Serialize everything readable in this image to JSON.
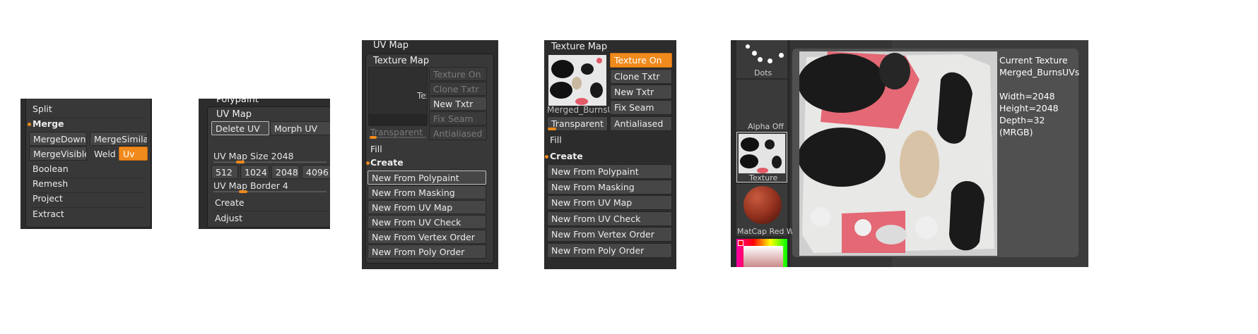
{
  "panel1": {
    "items": {
      "split": "Split",
      "merge": "Merge",
      "merge_down": "MergeDown",
      "merge_similar": "MergeSimilar",
      "merge_visible": "MergeVisible",
      "weld": "Weld",
      "uv": "Uv",
      "boolean": "Boolean",
      "remesh": "Remesh",
      "project": "Project",
      "extract": "Extract"
    }
  },
  "panel2": {
    "polypaint": "Polypaint",
    "uv_map": "UV Map",
    "delete_uv": "Delete UV",
    "morph_uv": "Morph UV",
    "uv_map_size_label": "UV Map Size",
    "uv_map_size_value": "2048",
    "sizes": [
      "512",
      "1024",
      "2048",
      "4096"
    ],
    "uv_map_border_label": "UV Map Border",
    "uv_map_border_value": "4",
    "create": "Create",
    "adjust": "Adjust"
  },
  "panel3": {
    "uv_map": "UV Map",
    "texture_map": "Texture Map",
    "thumb_text": "Tex",
    "texture_on": "Texture On",
    "clone_txtr": "Clone Txtr",
    "new_txtr": "New Txtr",
    "fix_seam": "Fix Seam",
    "transparent": "Transparent",
    "antialiased": "Antialiased",
    "fill": "Fill",
    "create": "Create",
    "new_from": [
      "New From Polypaint",
      "New From Masking",
      "New From UV Map",
      "New From UV Check",
      "New From Vertex Order",
      "New From Poly Order"
    ]
  },
  "panel4": {
    "texture_map": "Texture Map",
    "texture_name": "Merged_BurnsU",
    "texture_on": "Texture On",
    "clone_txtr": "Clone Txtr",
    "new_txtr": "New Txtr",
    "fix_seam": "Fix Seam",
    "transparent_label": "Transparent",
    "transparent_value": "0",
    "antialiased": "Antialiased",
    "fill": "Fill",
    "create": "Create",
    "new_from": [
      "New From Polypaint",
      "New From Masking",
      "New From UV Map",
      "New From UV Check",
      "New From Vertex Order",
      "New From Poly Order"
    ]
  },
  "panel5": {
    "dots_label": "Dots",
    "alpha_label": "Alpha Off",
    "texture_label": "Texture",
    "matcap_label": "MatCap Red Wa",
    "info": {
      "title": "Current Texture",
      "name": "Merged_BurnsUVs",
      "width": "Width=2048",
      "height": "Height=2048",
      "depth": "Depth=32 (MRGB)"
    }
  },
  "colors": {
    "accent": "#f08a1c",
    "panel": "#2c2c2c",
    "inner": "#383838"
  }
}
